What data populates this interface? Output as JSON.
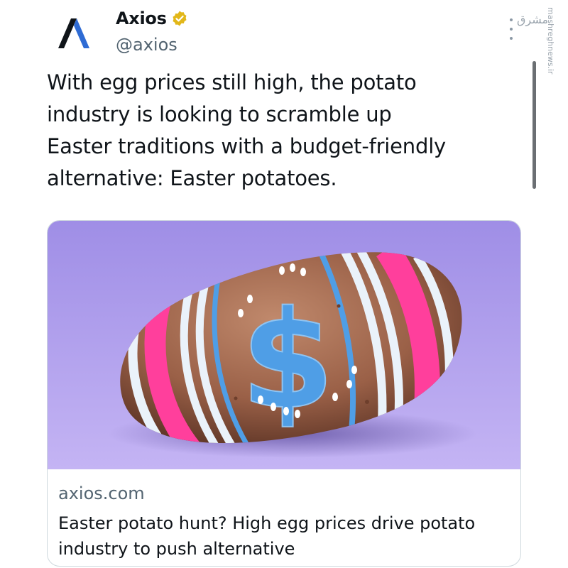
{
  "account": {
    "display_name": "Axios",
    "handle": "@axios",
    "verified": true,
    "logo_icon": "axios-logo-icon",
    "badge_color": "#e2b719"
  },
  "tweet": {
    "text_lines": [
      "With egg prices still high, the potato",
      "industry is looking to scramble up",
      "Easter traditions with a budget-friendly",
      "alternative: Easter potatoes."
    ]
  },
  "link_card": {
    "domain": "axios.com",
    "title_lines": [
      "Easter potato hunt? High egg prices drive potato",
      "industry to push alternative"
    ],
    "image_icon": "painted-easter-potato-image",
    "image_text": "$"
  },
  "watermark": {
    "text_fa": "مشرق",
    "url": "mashreghnews.ir"
  },
  "colors": {
    "text_primary": "#0f1419",
    "text_secondary": "#536471",
    "card_background": "#a996e6",
    "stripe_pink": "#ff3f9c",
    "stripe_blue": "#4f9ee6",
    "stripe_white": "#eaf2fa"
  }
}
